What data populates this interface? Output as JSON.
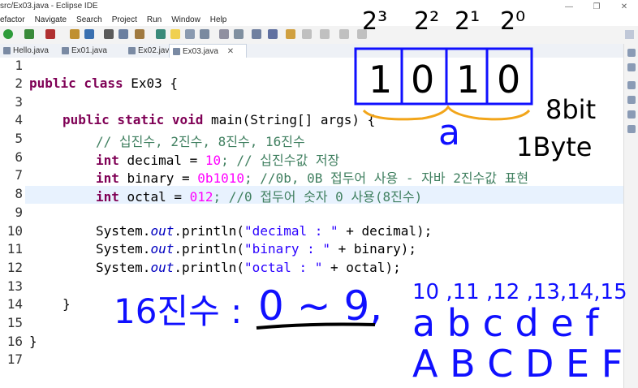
{
  "window": {
    "title": "src/Ex03.java - Eclipse IDE",
    "controls": [
      "—",
      "❐",
      "✕"
    ]
  },
  "menu": [
    "efactor",
    "Navigate",
    "Search",
    "Project",
    "Run",
    "Window",
    "Help"
  ],
  "tabs": [
    {
      "label": "Hello.java",
      "active": false
    },
    {
      "label": "Ex01.java",
      "active": false
    },
    {
      "label": "Ex02.java",
      "active": false
    },
    {
      "label": "Ex03.java",
      "active": true,
      "close": "✕"
    }
  ],
  "gutter": {
    "line_numbers": [
      "1",
      "2",
      "3",
      "4",
      "5",
      "6",
      "7",
      "8",
      "9",
      "10",
      "11",
      "12",
      "13",
      "14",
      "15",
      "16",
      "17"
    ]
  },
  "code": {
    "l2_kw": "public class",
    "l2_name": " Ex03 {",
    "l4_kw": "public static void",
    "l4_rest": " main(String[] args) {",
    "l5_comment": "// 십진수, 2진수, 8진수, 16진수",
    "l6_type": "int",
    "l6_decl": " decimal = ",
    "l6_num": "10",
    "l6_comment": "; // 십진수값 저장",
    "l7_type": "int",
    "l7_decl": " binary = ",
    "l7_num": "0b1010",
    "l7_comment": "; //0b, 0B 접두어 사용 - 자바 2진수값 표현",
    "l8_type": "int",
    "l8_decl": " octal = ",
    "l8_num": "012",
    "l8_comment": "; //0 접두어 숫자 0 사용(8진수)",
    "l10_sys": "System.",
    "l10_out": "out",
    "l10_call": ".println(",
    "l10_str": "\"decimal : \"",
    "l10_rest": " + decimal);",
    "l11_sys": "System.",
    "l11_out": "out",
    "l11_call": ".println(",
    "l11_str": "\"binary : \"",
    "l11_rest": " + binary);",
    "l12_sys": "System.",
    "l12_out": "out",
    "l12_call": ".println(",
    "l12_str": "\"octal : \"",
    "l12_rest": " + octal);",
    "l14_brace": "}",
    "l16_brace": "}"
  },
  "annotations": {
    "powers": [
      "2³",
      "2²",
      "2¹",
      "2⁰"
    ],
    "bits": [
      "1",
      "0",
      "1",
      "0"
    ],
    "brace_label": "a",
    "size_1": "8bit",
    "size_2": "1Byte",
    "hex_label": "16진수 :",
    "hex_range": "0 ~ 9,",
    "hex_numbers": "10 ,11 ,12 ,13,14,15",
    "hex_lower": "a  b  c  d e f",
    "hex_upper": "A  B  C D E F",
    "ink_black": "#000000",
    "ink_blue": "#1010ff",
    "ink_orange": "#f2a51a"
  }
}
